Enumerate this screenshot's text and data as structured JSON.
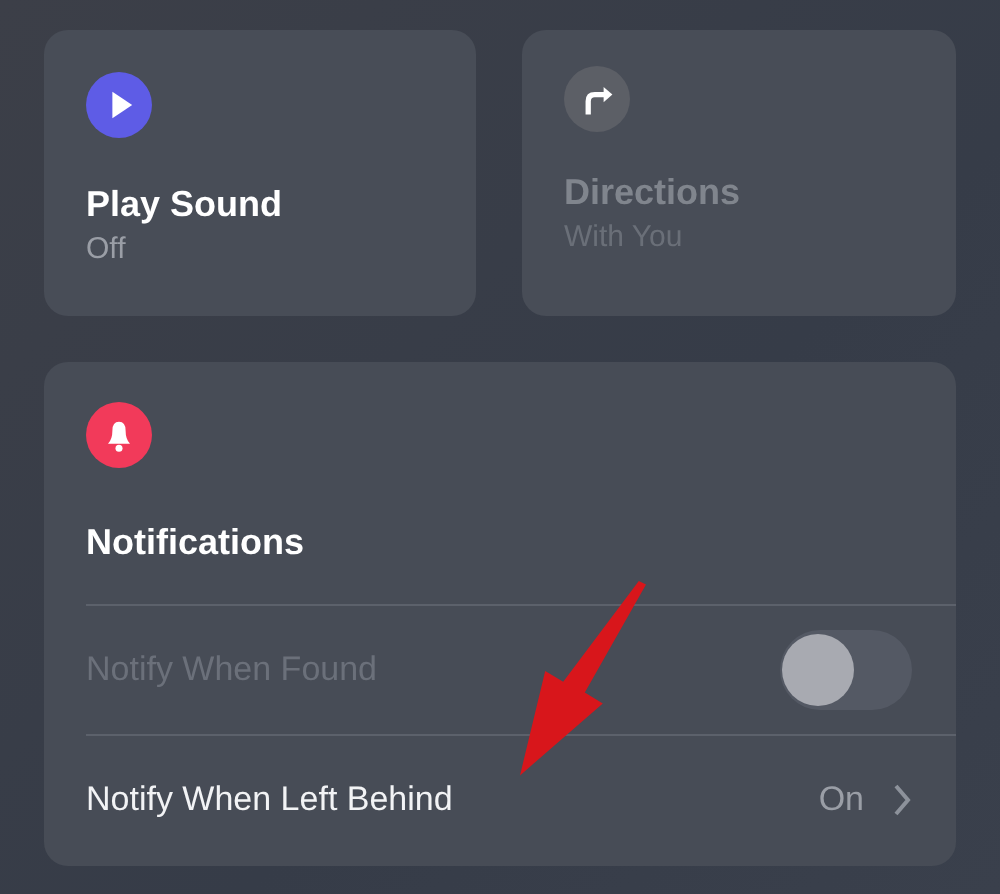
{
  "actions": [
    {
      "kind": "sound",
      "title": "Play Sound",
      "subtitle": "Off",
      "disabled": false
    },
    {
      "kind": "directions",
      "title": "Directions",
      "subtitle": "With You",
      "disabled": true
    }
  ],
  "notifications": {
    "title": "Notifications",
    "rows": [
      {
        "kind": "toggle",
        "label": "Notify When Found",
        "disabled": true,
        "on": false
      },
      {
        "kind": "disclosure",
        "label": "Notify When Left Behind",
        "disabled": false,
        "value": "On"
      }
    ]
  }
}
